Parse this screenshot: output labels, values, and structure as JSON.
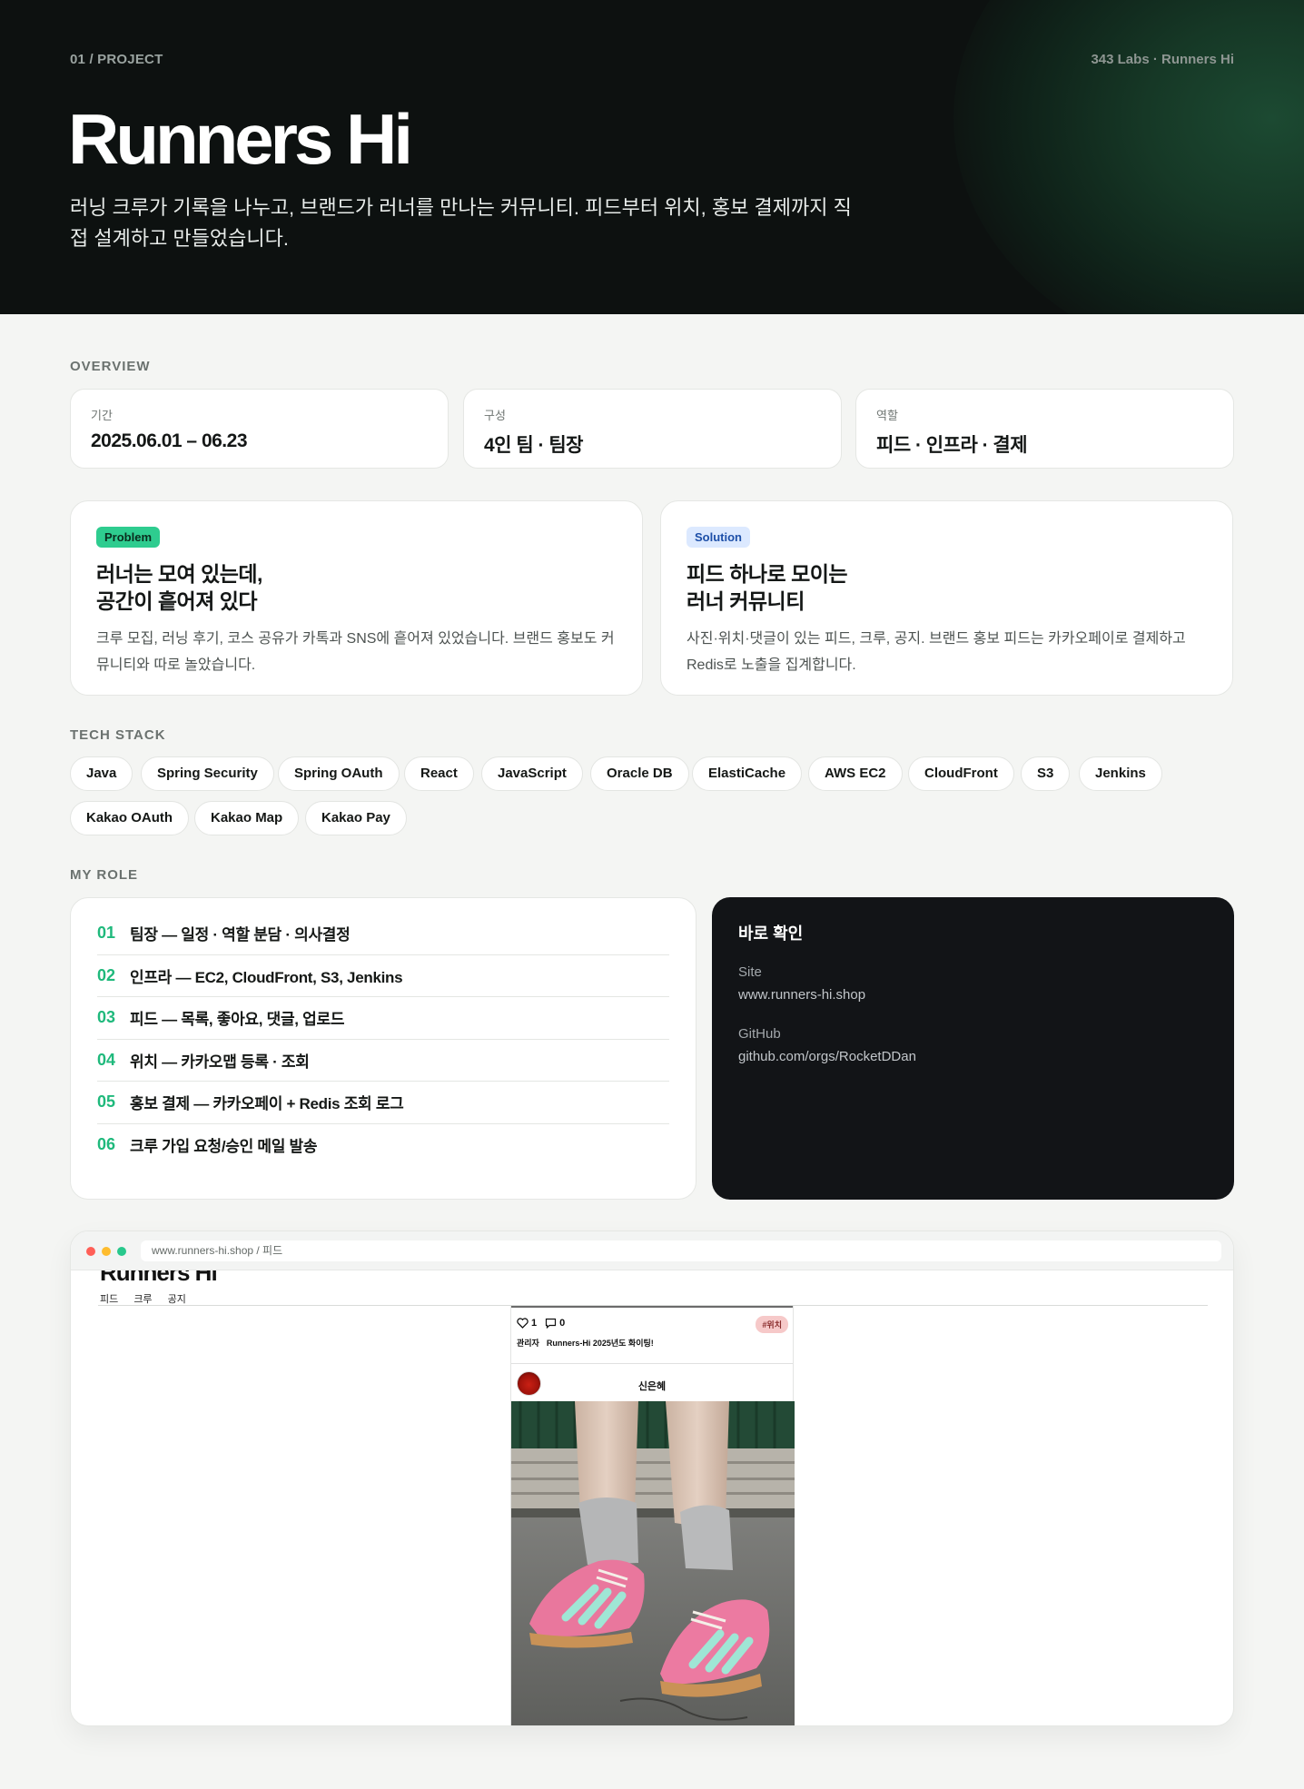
{
  "hero": {
    "eyebrow": "01 / PROJECT",
    "tag": "343 Labs · Runners Hi",
    "title": "Runners Hi",
    "lead": "러닝 크루가 기록을 나누고, 브랜드가 러너를 만나는 커뮤니티. 피드부터 위치, 홍보 결제까지 직접 설계하고 만들었습니다."
  },
  "overview": {
    "label": "OVERVIEW",
    "cards": [
      {
        "key": "기간",
        "value": "2025.06.01 – 06.23"
      },
      {
        "key": "구성",
        "value": "4인 팀 · 팀장"
      },
      {
        "key": "역할",
        "value": "피드 · 인프라 · 결제"
      }
    ]
  },
  "problem": {
    "badge": "Problem",
    "title_line1": "러너는 모여 있는데,",
    "title_line2": "공간이 흩어져 있다",
    "desc": "크루 모집, 러닝 후기, 코스 공유가 카톡과 SNS에 흩어져 있었습니다. 브랜드 홍보도 커뮤니티와 따로 놀았습니다."
  },
  "solution": {
    "badge": "Solution",
    "title_line1": "피드 하나로 모이는",
    "title_line2": "러너 커뮤니티",
    "desc": "사진·위치·댓글이 있는 피드, 크루, 공지. 브랜드 홍보 피드는 카카오페이로 결제하고 Redis로 노출을 집계합니다."
  },
  "tech": {
    "label": "TECH STACK",
    "items": [
      "Java",
      "Spring Security",
      "Spring OAuth",
      "React",
      "JavaScript",
      "Oracle DB",
      "ElastiCache",
      "AWS EC2",
      "CloudFront",
      "S3",
      "Jenkins",
      "Kakao OAuth",
      "Kakao Map",
      "Kakao Pay"
    ]
  },
  "role": {
    "label": "MY ROLE",
    "items": [
      {
        "num": "01",
        "text": "팀장 — 일정 · 역할 분담 · 의사결정"
      },
      {
        "num": "02",
        "text": "인프라 — EC2, CloudFront, S3, Jenkins"
      },
      {
        "num": "03",
        "text": "피드 — 목록, 좋아요, 댓글, 업로드"
      },
      {
        "num": "04",
        "text": "위치 — 카카오맵 등록 · 조회"
      },
      {
        "num": "05",
        "text": "홍보 결제 — 카카오페이 + Redis 조회 로그"
      },
      {
        "num": "06",
        "text": "크루 가입 요청/승인 메일 발송"
      }
    ]
  },
  "quick": {
    "title": "바로 확인",
    "site_label": "Site",
    "site_value": "www.runners-hi.shop",
    "github_label": "GitHub",
    "github_value": "github.com/orgs/RocketDDan"
  },
  "browser": {
    "url": "www.runners-hi.shop / 피드",
    "site_logo": "Runners Hi",
    "nav": [
      "피드",
      "크루",
      "공지"
    ],
    "feed": {
      "likes": "1",
      "comments": "0",
      "tag": "#위치",
      "author": "관리자",
      "post_title": "Runners-Hi 2025년도 화이팅!",
      "user": "신은혜"
    }
  },
  "colors": {
    "hero_bg": "#0d1110",
    "accent": "#1fb97c",
    "problem_badge": "#2ecc8f",
    "solution_badge": "#dce9ff",
    "dark_card": "#121417"
  }
}
